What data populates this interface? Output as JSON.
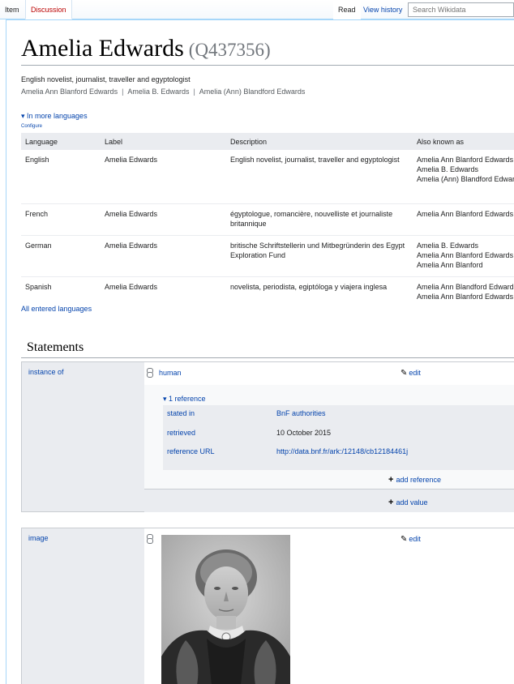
{
  "tabs": {
    "item": "Item",
    "discussion": "Discussion",
    "read": "Read",
    "history": "View history"
  },
  "search": {
    "placeholder": "Search Wikidata"
  },
  "entity": {
    "label": "Amelia Edwards",
    "id": "(Q437356)",
    "description": "English novelist, journalist, traveller and egyptologist",
    "aliases": [
      "Amelia Ann Blanford Edwards",
      "Amelia B. Edwards",
      "Amelia (Ann) Blandford Edwards"
    ]
  },
  "languages": {
    "toggle": "▾ In more languages",
    "configure": "Configure",
    "headers": [
      "Language",
      "Label",
      "Description",
      "Also known as"
    ],
    "rows": [
      {
        "language": "English",
        "label": "Amelia Edwards",
        "description": "English novelist, journalist, traveller and egyptologist",
        "aka": [
          "Amelia Ann Blanford Edwards",
          "Amelia B. Edwards",
          "Amelia (Ann) Blandford Edwards"
        ]
      },
      {
        "language": "French",
        "label": "Amelia Edwards",
        "description": "égyptologue, romancière, nouvelliste et journaliste britannique",
        "aka": [
          "Amelia Ann Blanford Edwards"
        ]
      },
      {
        "language": "German",
        "label": "Amelia Edwards",
        "description": "britische Schriftstellerin und Mitbegründerin des Egypt Exploration Fund",
        "aka": [
          "Amelia B. Edwards",
          "Amelia Ann Blanford Edwards",
          "Amelia Ann Blanford"
        ]
      },
      {
        "language": "Spanish",
        "label": "Amelia Edwards",
        "description": "novelista, periodista, egiptóloga y viajera inglesa",
        "aka": [
          "Amelia Ann Blandford Edwards",
          "Amelia Ann Blanford Edwards"
        ]
      }
    ],
    "all_link": "All entered languages"
  },
  "statements": {
    "heading": "Statements",
    "instance_of": {
      "property": "instance of",
      "value": "human",
      "edit": "edit",
      "ref_toggle": "▾ 1 reference",
      "refs": [
        {
          "key": "stated in",
          "value": "BnF authorities"
        },
        {
          "key": "retrieved",
          "value": "10 October 2015"
        },
        {
          "key": "reference URL",
          "value": "http://data.bnf.fr/ark:/12148/cb12184461j"
        }
      ],
      "add_reference": "add reference",
      "add_value": "add value"
    },
    "image": {
      "property": "image",
      "edit": "edit"
    }
  },
  "icons": {
    "edit": "pencil-icon",
    "rank": "rank-normal-icon",
    "add": "plus-icon"
  }
}
